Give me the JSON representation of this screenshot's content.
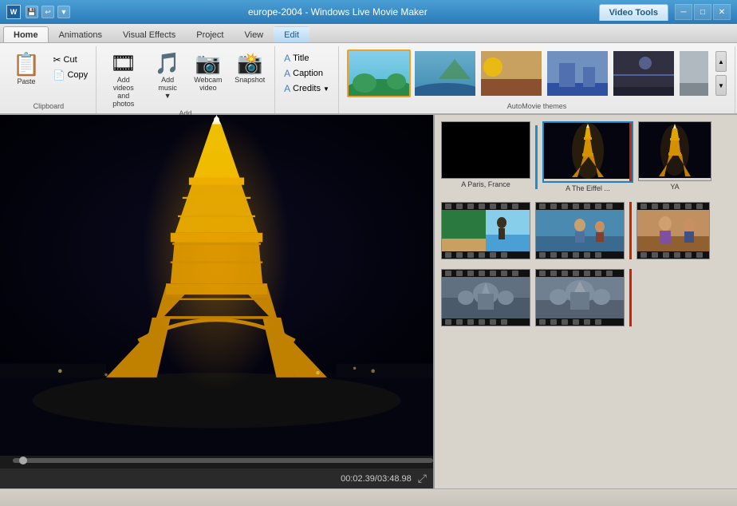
{
  "titleBar": {
    "appName": "europe-2004 - Windows Live Movie Maker",
    "videoToolsTab": "Video Tools",
    "editTab": "Edit",
    "controls": [
      "─",
      "□",
      "✕"
    ]
  },
  "ribbonTabs": {
    "tabs": [
      "Home",
      "Animations",
      "Visual Effects",
      "Project",
      "View",
      "Edit"
    ],
    "activeTab": "Home",
    "videoToolsLabel": "Video Tools"
  },
  "ribbon": {
    "clipboard": {
      "label": "Clipboard",
      "paste": "Paste",
      "cut": "Cut",
      "copy": "Copy"
    },
    "add": {
      "label": "Add",
      "addVideos": "Add videos\nand photos",
      "addMusic": "Add\nmusic",
      "webcam": "Webcam\nvideo",
      "snapshot": "Snapshot"
    },
    "text": {
      "title": "Title",
      "caption": "Caption",
      "credits": "Credits"
    },
    "themes": {
      "label": "AutoMovie themes",
      "items": [
        "nature",
        "ocean",
        "warm",
        "cool",
        "dark",
        "extra"
      ]
    }
  },
  "preview": {
    "timecode": "00:02.39/03:48.98"
  },
  "storyboard": {
    "clips": [
      {
        "id": 1,
        "label": "A Paris, France",
        "type": "black",
        "selected": false
      },
      {
        "id": 2,
        "label": "A The Eiffel ...",
        "type": "eiffel-night",
        "selected": true
      },
      {
        "id": 3,
        "label": "YA",
        "type": "eiffel-night2",
        "selected": false
      }
    ],
    "filmClips": [
      {
        "id": 4,
        "type": "beach",
        "color1": "#4ab870",
        "color2": "#87ceeb"
      },
      {
        "id": 5,
        "type": "person",
        "color1": "#2a6090",
        "color2": "#4a9fd4"
      },
      {
        "id": 6,
        "type": "person2",
        "color1": "#c08040",
        "color2": "#906030"
      }
    ],
    "buildingClips": [
      {
        "id": 7,
        "type": "building",
        "color": "#607080"
      },
      {
        "id": 8,
        "type": "building2",
        "color": "#708090"
      }
    ]
  }
}
